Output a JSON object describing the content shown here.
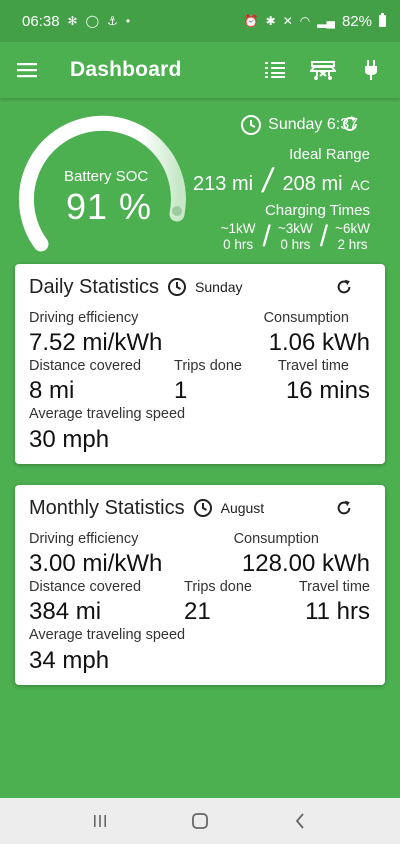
{
  "status_bar": {
    "time": "06:38",
    "battery_percent": "82%"
  },
  "app_bar": {
    "title": "Dashboard",
    "icons": [
      "menu-icon",
      "list-icon",
      "car-icon",
      "plug-icon"
    ]
  },
  "hero": {
    "soc_label": "Battery SOC",
    "soc_value": "91 %",
    "soc_fraction": 0.91,
    "day_time": "Sunday 6:37",
    "ideal_range_label": "Ideal Range",
    "range_1": "213 mi",
    "range_2": "208 mi",
    "range_ac": "AC",
    "charging_times_label": "Charging Times",
    "charging": [
      {
        "power": "~1kW",
        "time": "0 hrs"
      },
      {
        "power": "~3kW",
        "time": "0 hrs"
      },
      {
        "power": "~6kW",
        "time": "2 hrs"
      }
    ]
  },
  "daily": {
    "title": "Daily Statistics",
    "period": "Sunday",
    "driving_efficiency_label": "Driving efficiency",
    "driving_efficiency": "7.52 mi/kWh",
    "consumption_label": "Consumption",
    "consumption": "1.06 kWh",
    "distance_label": "Distance covered",
    "distance": "8 mi",
    "trips_label": "Trips done",
    "trips": "1",
    "travel_time_label": "Travel time",
    "travel_time": "16 mins",
    "avg_speed_label": "Average traveling speed",
    "avg_speed": "30 mph"
  },
  "monthly": {
    "title": "Monthly Statistics",
    "period": "August",
    "driving_efficiency_label": "Driving efficiency",
    "driving_efficiency": "3.00 mi/kWh",
    "consumption_label": "Consumption",
    "consumption": "128.00 kWh",
    "distance_label": "Distance covered",
    "distance": "384 mi",
    "trips_label": "Trips done",
    "trips": "21",
    "travel_time_label": "Travel time",
    "travel_time": "11 hrs",
    "avg_speed_label": "Average traveling speed",
    "avg_speed": "34 mph"
  },
  "colors": {
    "primary": "#4caf50",
    "status_bar": "#43a047",
    "card": "#ffffff",
    "nav_bar": "#ededed"
  }
}
